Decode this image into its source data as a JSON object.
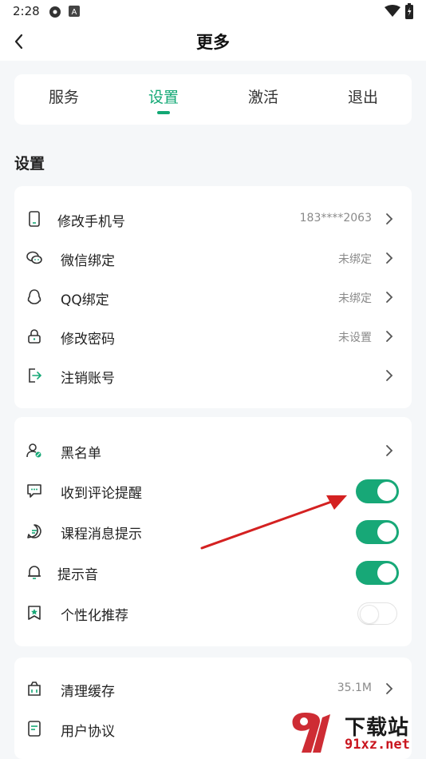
{
  "status_bar": {
    "time": "2:28"
  },
  "header": {
    "title": "更多"
  },
  "tabs": [
    {
      "label": "服务",
      "active": false
    },
    {
      "label": "设置",
      "active": true
    },
    {
      "label": "激活",
      "active": false
    },
    {
      "label": "退出",
      "active": false
    }
  ],
  "section": {
    "title": "设置"
  },
  "account_rows": [
    {
      "label": "修改手机号",
      "value": "183****2063",
      "icon": "phone-icon"
    },
    {
      "label": "微信绑定",
      "value": "未绑定",
      "icon": "wechat-icon"
    },
    {
      "label": "QQ绑定",
      "value": "未绑定",
      "icon": "qq-icon"
    },
    {
      "label": "修改密码",
      "value": "未设置",
      "icon": "lock-icon"
    },
    {
      "label": "注销账号",
      "value": "",
      "icon": "logout-icon"
    }
  ],
  "notify_rows": [
    {
      "label": "黑名单",
      "icon": "blocked-user-icon",
      "type": "link"
    },
    {
      "label": "收到评论提醒",
      "icon": "comment-icon",
      "type": "toggle",
      "on": true
    },
    {
      "label": "课程消息提示",
      "icon": "message-icon",
      "type": "toggle",
      "on": true
    },
    {
      "label": "提示音",
      "icon": "bell-icon",
      "type": "toggle",
      "on": true
    },
    {
      "label": "个性化推荐",
      "icon": "recommend-icon",
      "type": "toggle",
      "on": false
    }
  ],
  "other_rows": [
    {
      "label": "清理缓存",
      "value": "35.1M",
      "icon": "clear-cache-icon"
    },
    {
      "label": "用户协议",
      "value": "",
      "icon": "document-icon"
    }
  ],
  "watermark": {
    "top": "下载站",
    "bottom": "91xz.net"
  },
  "colors": {
    "accent": "#12a874",
    "annotation_arrow": "#d42121"
  }
}
